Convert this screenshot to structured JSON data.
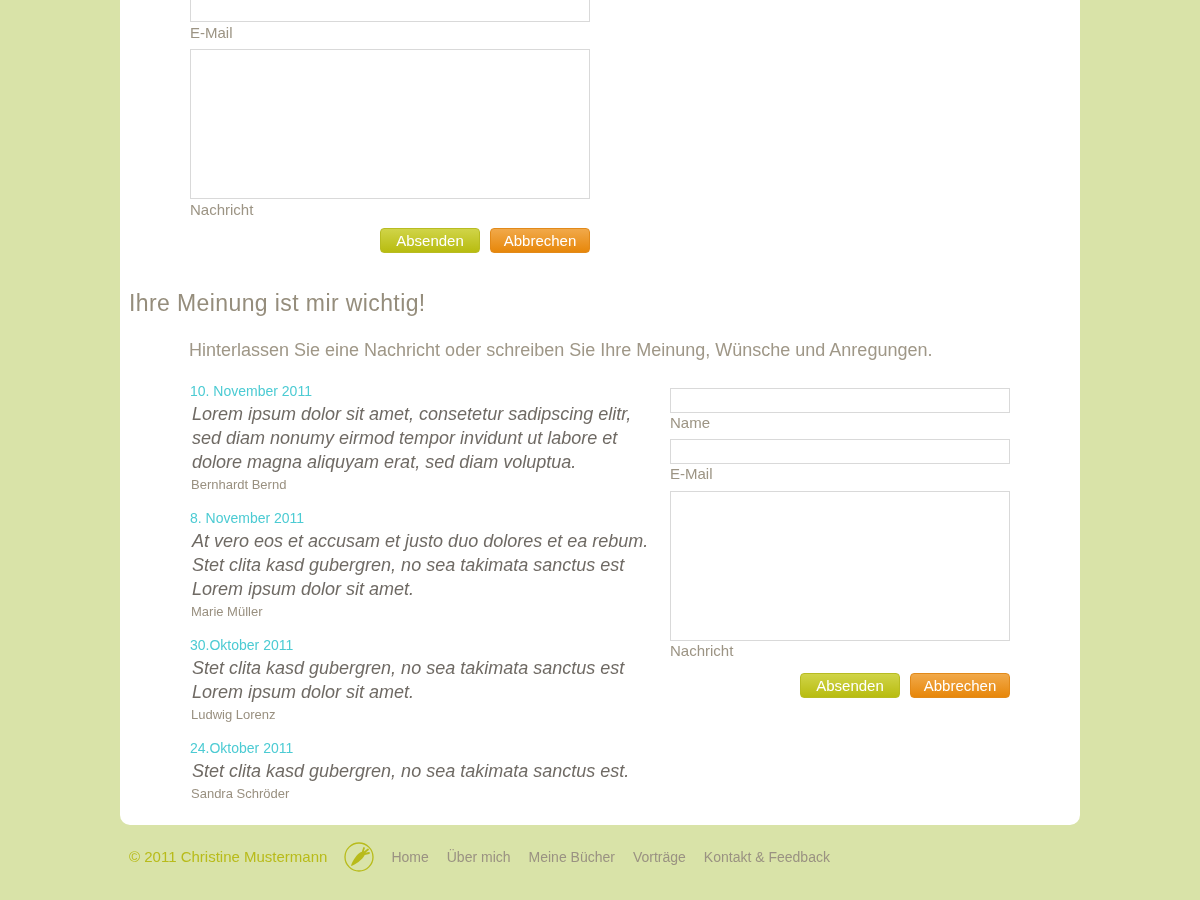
{
  "top_form": {
    "fields": [
      {
        "kind": "input",
        "label": "E-Mail"
      },
      {
        "kind": "textarea",
        "label": "Nachricht"
      }
    ],
    "buttons": [
      {
        "kind": "submit",
        "label": "Absenden"
      },
      {
        "kind": "cancel",
        "label": "Abbrechen"
      }
    ]
  },
  "guestbook": {
    "heading": "Ihre Meinung ist mir wichtig!",
    "intro": "Hinterlassen Sie eine Nachricht oder schreiben Sie Ihre Meinung, Wünsche und Anregungen.",
    "entries": [
      {
        "date": "10. November 2011",
        "message": "Lorem ipsum dolor sit amet, consetetur sadipscing elitr, sed diam nonumy eirmod tempor invidunt ut labore et dolore magna aliquyam erat, sed diam voluptua.",
        "author": "Bernhardt Bernd"
      },
      {
        "date": "8. November 2011",
        "message": "At vero eos et accusam et justo duo dolores et ea rebum. Stet clita kasd gubergren, no sea takimata sanctus est Lorem ipsum dolor sit amet.",
        "author": "Marie Müller"
      },
      {
        "date": "30.Oktober 2011",
        "message": "Stet clita kasd gubergren, no sea takimata sanctus est Lorem ipsum dolor sit amet.",
        "author": "Ludwig Lorenz"
      },
      {
        "date": "24.Oktober 2011",
        "message": "Stet clita kasd gubergren, no sea takimata sanctus est.",
        "author": "Sandra Schröder"
      }
    ],
    "form": {
      "fields": [
        {
          "kind": "input",
          "label": "Name"
        },
        {
          "kind": "input",
          "label": "E-Mail"
        },
        {
          "kind": "textarea",
          "label": "Nachricht"
        }
      ],
      "buttons": [
        {
          "kind": "submit",
          "label": "Absenden"
        },
        {
          "kind": "cancel",
          "label": "Abbrechen"
        }
      ]
    }
  },
  "footer": {
    "copyright": "© 2011 Christine Mustermann",
    "links": [
      "Home",
      "Über mich",
      "Meine Bücher",
      "Vorträge",
      "Kontakt & Feedback"
    ]
  }
}
